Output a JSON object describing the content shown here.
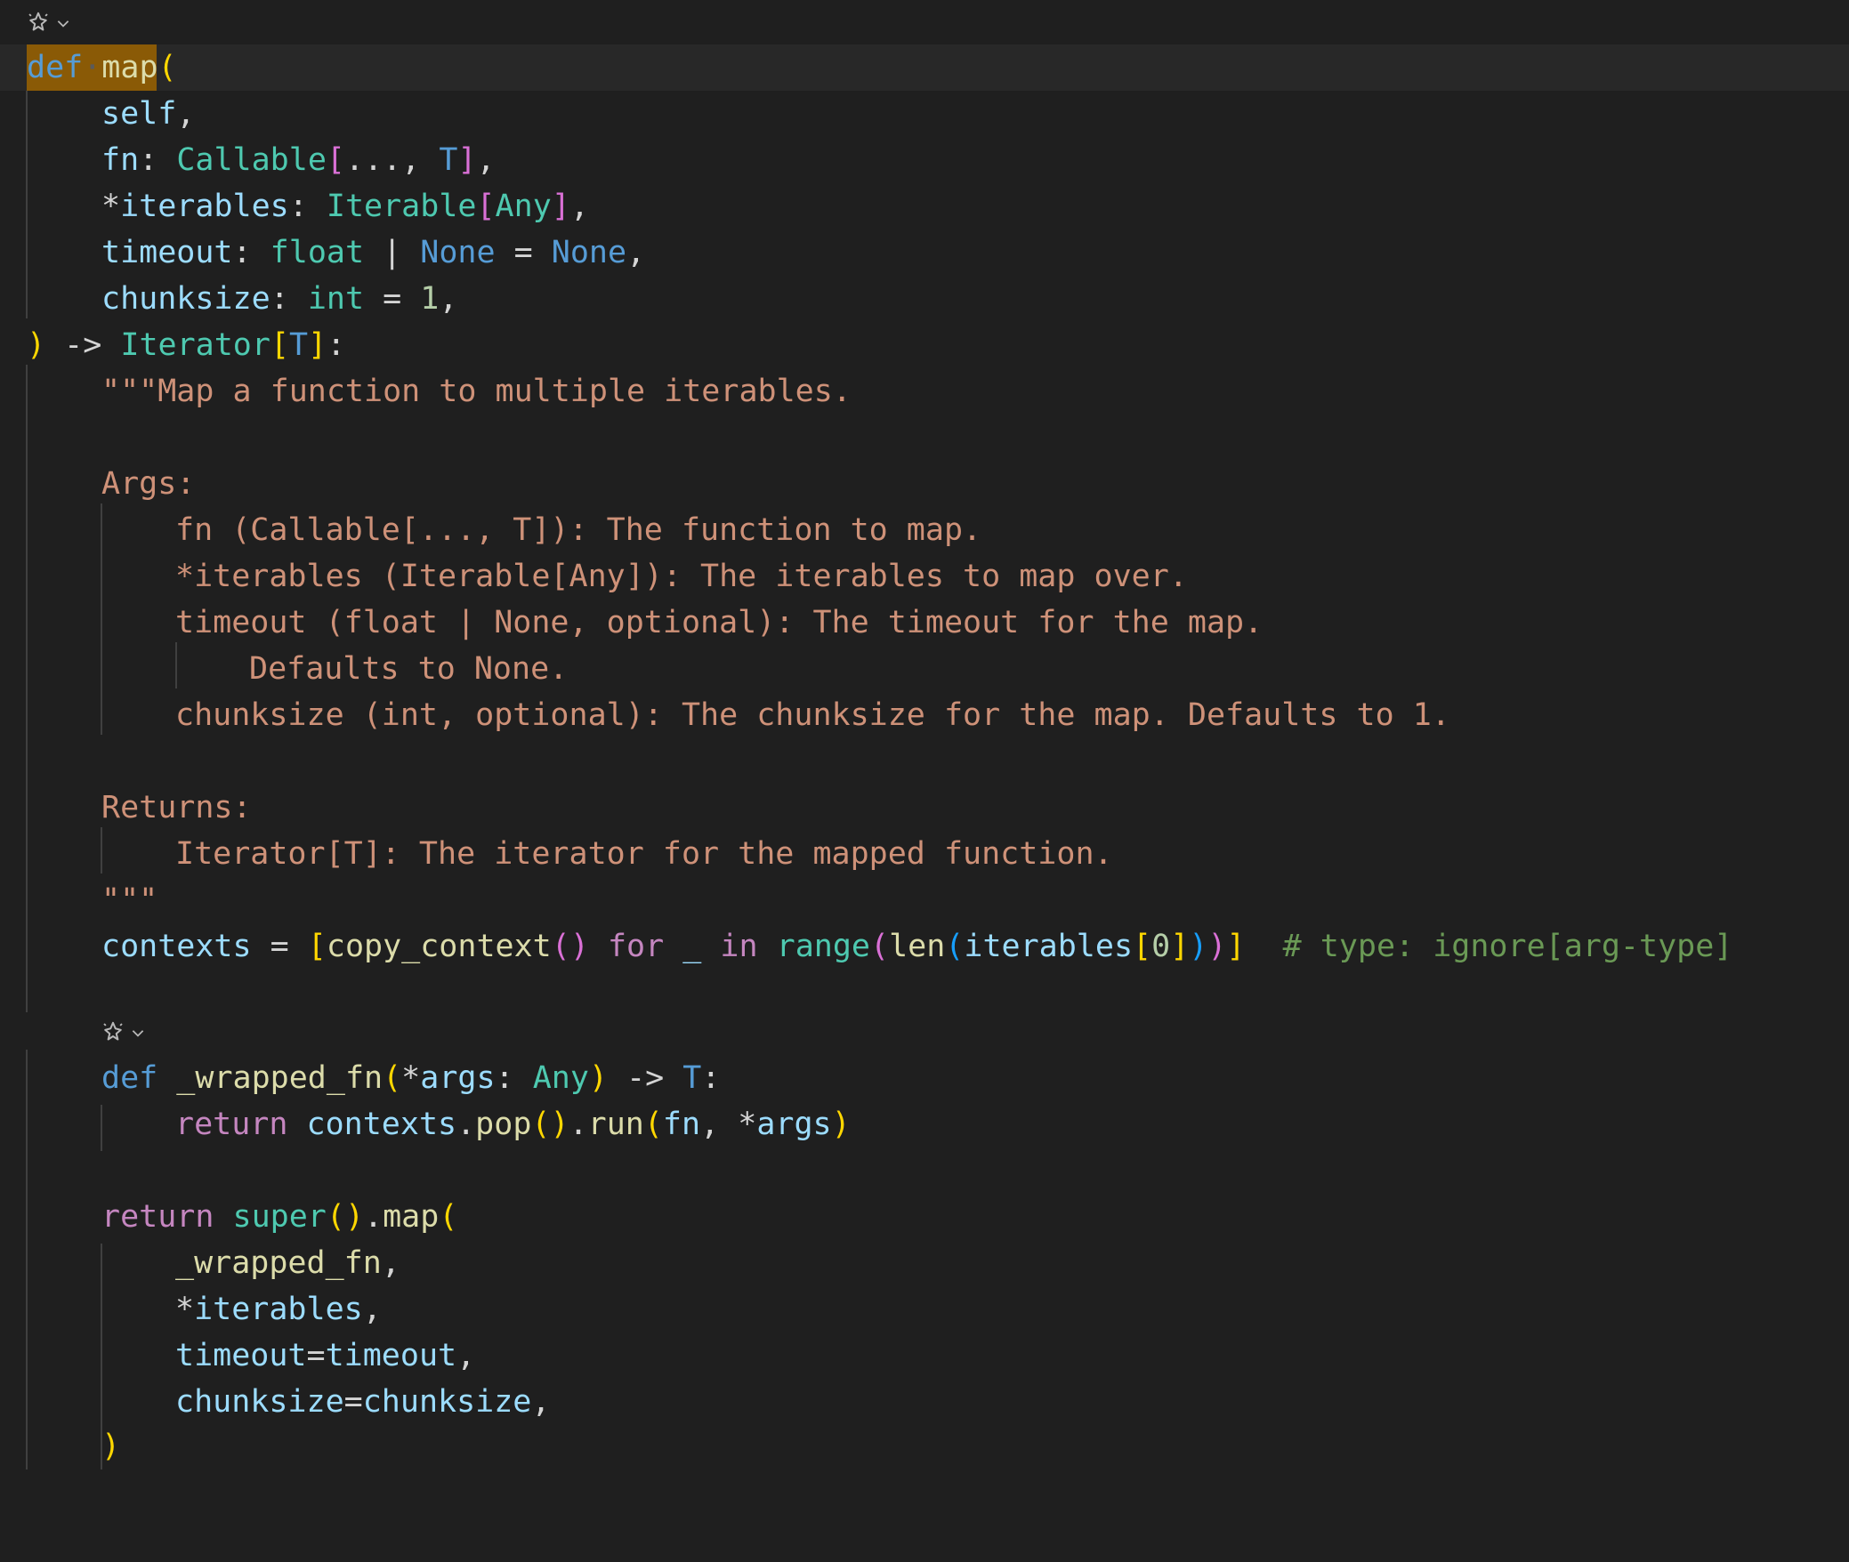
{
  "editor": {
    "codelens_label": "copilot-sparkle",
    "lines": {
      "l1": [
        "def",
        "·",
        "map",
        "("
      ],
      "l2": [
        "self",
        ","
      ],
      "l3": [
        "fn",
        ": ",
        "Callable",
        "[",
        "..., ",
        "T",
        "]",
        ","
      ],
      "l4": [
        "*",
        "iterables",
        ": ",
        "Iterable",
        "[",
        "Any",
        "]",
        ","
      ],
      "l5": [
        "timeout",
        ": ",
        "float",
        " | ",
        "None",
        " = ",
        "None",
        ","
      ],
      "l6": [
        "chunksize",
        ": ",
        "int",
        " = ",
        "1",
        ","
      ],
      "l7": [
        ")",
        " -> ",
        "Iterator",
        "[",
        "T",
        "]",
        ":"
      ],
      "l8": "\"\"\"Map a function to multiple iterables.",
      "l10": "Args:",
      "l11": "fn (Callable[..., T]): The function to map.",
      "l12": "*iterables (Iterable[Any]): The iterables to map over.",
      "l13": "timeout (float | None, optional): The timeout for the map.",
      "l14": "Defaults to None.",
      "l15": "chunksize (int, optional): The chunksize for the map. Defaults to 1.",
      "l17": "Returns:",
      "l18": "Iterator[T]: The iterator for the mapped function.",
      "l19": "\"\"\"",
      "l20": [
        "contexts",
        " = ",
        "[",
        "copy_context",
        "(",
        ")",
        " for ",
        "_",
        " in ",
        "range",
        "(",
        "len",
        "(",
        "iterables",
        "[",
        "0",
        "]",
        ")",
        ")",
        "]",
        "  # type: ignore[arg-type]"
      ],
      "l22": [
        "def",
        " ",
        "_wrapped_fn",
        "(",
        "*",
        "args",
        ": ",
        "Any",
        ")",
        " -> ",
        "T",
        ":"
      ],
      "l23": [
        "return",
        " ",
        "contexts",
        ".",
        "pop",
        "(",
        ")",
        ".",
        "run",
        "(",
        "fn",
        ", ",
        "*",
        "args",
        ")"
      ],
      "l25": [
        "return",
        " ",
        "super",
        "(",
        ")",
        ".",
        "map",
        "("
      ],
      "l26": [
        "_wrapped_fn",
        ","
      ],
      "l27": [
        "*",
        "iterables",
        ","
      ],
      "l28": [
        "timeout",
        "=",
        "timeout",
        ","
      ],
      "l29": [
        "chunksize",
        "=",
        "chunksize",
        ","
      ],
      "l30": [
        ")"
      ]
    }
  }
}
